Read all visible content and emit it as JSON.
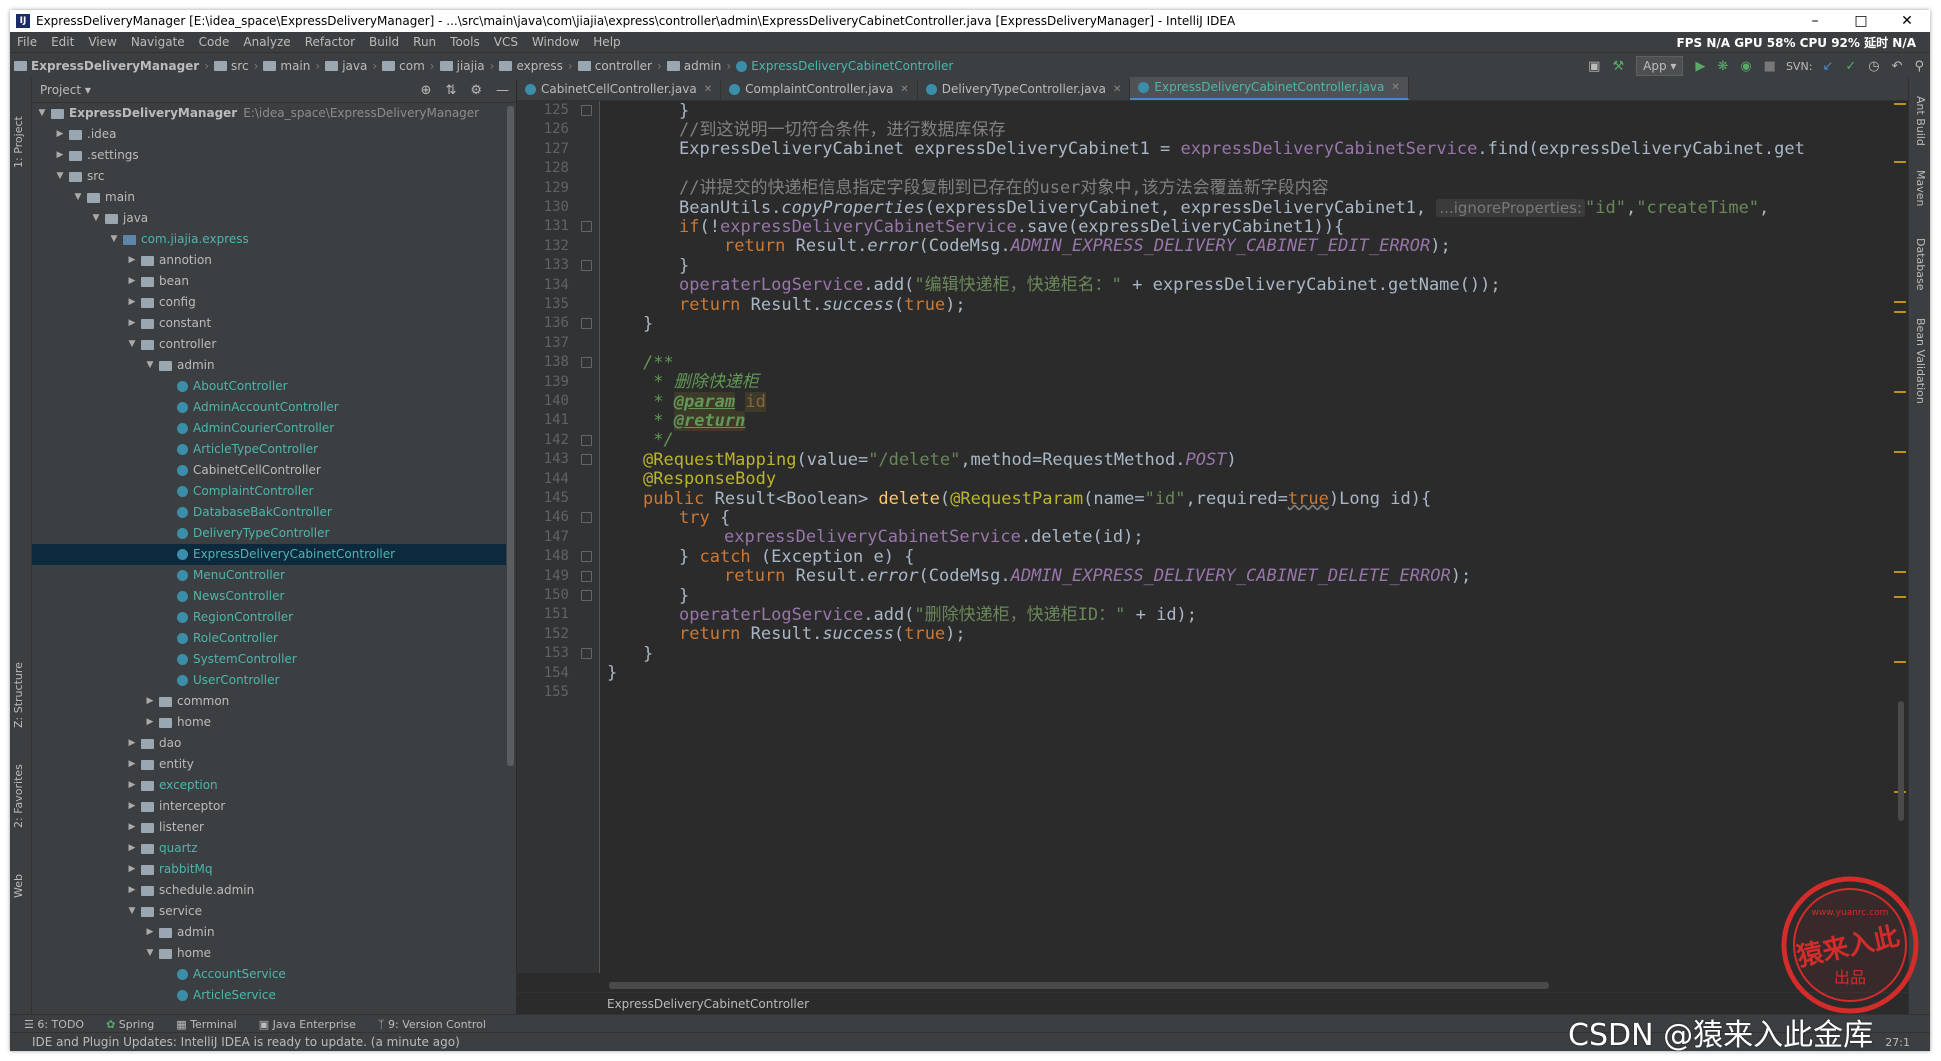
{
  "window": {
    "title": "ExpressDeliveryManager [E:\\idea_space\\ExpressDeliveryManager] - ...\\src\\main\\java\\com\\jiajia\\express\\controller\\admin\\ExpressDeliveryCabinetController.java [ExpressDeliveryManager] - IntelliJ IDEA",
    "app_icon": "IJ"
  },
  "menu": {
    "items": [
      "File",
      "Edit",
      "View",
      "Navigate",
      "Code",
      "Analyze",
      "Refactor",
      "Build",
      "Run",
      "Tools",
      "VCS",
      "Window",
      "Help"
    ],
    "perf": "FPS N/A GPU 58% CPU 92% 延时 N/A"
  },
  "nav": {
    "crumbs": [
      "ExpressDeliveryManager",
      "src",
      "main",
      "java",
      "com",
      "jiajia",
      "express",
      "controller",
      "admin"
    ],
    "current": "ExpressDeliveryCabinetController",
    "run_config": "App ▾",
    "svn_label": "SVN:"
  },
  "left_strip": {
    "project": "1: Project",
    "structure": "Z: Structure",
    "favorites": "2: Favorites",
    "web": "Web"
  },
  "right_strip": {
    "ant": "Ant Build",
    "maven": "Maven",
    "database": "Database",
    "bean": "Bean Validation"
  },
  "project": {
    "header": "Project ▾",
    "root_name": "ExpressDeliveryManager",
    "root_path": "E:\\idea_space\\ExpressDeliveryManager",
    "tree": [
      {
        "indent": 1,
        "arrow": "▶",
        "icon": "folder",
        "label": ".idea",
        "color": "normal"
      },
      {
        "indent": 1,
        "arrow": "▶",
        "icon": "folder",
        "label": ".settings",
        "color": "normal"
      },
      {
        "indent": 1,
        "arrow": "▼",
        "icon": "folder",
        "label": "src",
        "color": "normal"
      },
      {
        "indent": 2,
        "arrow": "▼",
        "icon": "folder",
        "label": "main",
        "color": "normal"
      },
      {
        "indent": 3,
        "arrow": "▼",
        "icon": "folder",
        "label": "java",
        "color": "normal"
      },
      {
        "indent": 4,
        "arrow": "▼",
        "icon": "pkg",
        "label": "com.jiajia.express",
        "color": "cyan"
      },
      {
        "indent": 5,
        "arrow": "▶",
        "icon": "folder",
        "label": "annotion",
        "color": "normal"
      },
      {
        "indent": 5,
        "arrow": "▶",
        "icon": "folder",
        "label": "bean",
        "color": "normal"
      },
      {
        "indent": 5,
        "arrow": "▶",
        "icon": "folder",
        "label": "config",
        "color": "normal"
      },
      {
        "indent": 5,
        "arrow": "▶",
        "icon": "folder",
        "label": "constant",
        "color": "normal"
      },
      {
        "indent": 5,
        "arrow": "▼",
        "icon": "folder",
        "label": "controller",
        "color": "normal"
      },
      {
        "indent": 6,
        "arrow": "▼",
        "icon": "folder",
        "label": "admin",
        "color": "normal"
      },
      {
        "indent": 7,
        "arrow": "",
        "icon": "cls",
        "label": "AboutController",
        "color": "cyan"
      },
      {
        "indent": 7,
        "arrow": "",
        "icon": "cls",
        "label": "AdminAccountController",
        "color": "cyan"
      },
      {
        "indent": 7,
        "arrow": "",
        "icon": "cls",
        "label": "AdminCourierController",
        "color": "cyan"
      },
      {
        "indent": 7,
        "arrow": "",
        "icon": "cls",
        "label": "ArticleTypeController",
        "color": "cyan"
      },
      {
        "indent": 7,
        "arrow": "",
        "icon": "cls",
        "label": "CabinetCellController",
        "color": "normal"
      },
      {
        "indent": 7,
        "arrow": "",
        "icon": "cls",
        "label": "ComplaintController",
        "color": "cyan"
      },
      {
        "indent": 7,
        "arrow": "",
        "icon": "cls",
        "label": "DatabaseBakController",
        "color": "cyan"
      },
      {
        "indent": 7,
        "arrow": "",
        "icon": "cls",
        "label": "DeliveryTypeController",
        "color": "cyan"
      },
      {
        "indent": 7,
        "arrow": "",
        "icon": "cls",
        "label": "ExpressDeliveryCabinetController",
        "color": "cyan",
        "selected": true
      },
      {
        "indent": 7,
        "arrow": "",
        "icon": "cls",
        "label": "MenuController",
        "color": "cyan"
      },
      {
        "indent": 7,
        "arrow": "",
        "icon": "cls",
        "label": "NewsController",
        "color": "cyan"
      },
      {
        "indent": 7,
        "arrow": "",
        "icon": "cls",
        "label": "RegionController",
        "color": "cyan"
      },
      {
        "indent": 7,
        "arrow": "",
        "icon": "cls",
        "label": "RoleController",
        "color": "cyan"
      },
      {
        "indent": 7,
        "arrow": "",
        "icon": "cls",
        "label": "SystemController",
        "color": "cyan"
      },
      {
        "indent": 7,
        "arrow": "",
        "icon": "cls",
        "label": "UserController",
        "color": "cyan"
      },
      {
        "indent": 6,
        "arrow": "▶",
        "icon": "folder",
        "label": "common",
        "color": "normal"
      },
      {
        "indent": 6,
        "arrow": "▶",
        "icon": "folder",
        "label": "home",
        "color": "normal"
      },
      {
        "indent": 5,
        "arrow": "▶",
        "icon": "folder",
        "label": "dao",
        "color": "normal"
      },
      {
        "indent": 5,
        "arrow": "▶",
        "icon": "folder",
        "label": "entity",
        "color": "normal"
      },
      {
        "indent": 5,
        "arrow": "▶",
        "icon": "folder",
        "label": "exception",
        "color": "cyan"
      },
      {
        "indent": 5,
        "arrow": "▶",
        "icon": "folder",
        "label": "interceptor",
        "color": "normal"
      },
      {
        "indent": 5,
        "arrow": "▶",
        "icon": "folder",
        "label": "listener",
        "color": "normal"
      },
      {
        "indent": 5,
        "arrow": "▶",
        "icon": "folder",
        "label": "quartz",
        "color": "cyan"
      },
      {
        "indent": 5,
        "arrow": "▶",
        "icon": "folder",
        "label": "rabbitMq",
        "color": "cyan"
      },
      {
        "indent": 5,
        "arrow": "▶",
        "icon": "folder",
        "label": "schedule.admin",
        "color": "normal"
      },
      {
        "indent": 5,
        "arrow": "▼",
        "icon": "folder",
        "label": "service",
        "color": "normal"
      },
      {
        "indent": 6,
        "arrow": "▶",
        "icon": "folder",
        "label": "admin",
        "color": "normal"
      },
      {
        "indent": 6,
        "arrow": "▼",
        "icon": "folder",
        "label": "home",
        "color": "normal"
      },
      {
        "indent": 7,
        "arrow": "",
        "icon": "cls",
        "label": "AccountService",
        "color": "cyan"
      },
      {
        "indent": 7,
        "arrow": "",
        "icon": "cls",
        "label": "ArticleService",
        "color": "cyan"
      }
    ]
  },
  "editor": {
    "tabs": [
      {
        "label": "CabinetCellController.java",
        "active": false
      },
      {
        "label": "ComplaintController.java",
        "active": false
      },
      {
        "label": "DeliveryTypeController.java",
        "active": false
      },
      {
        "label": "ExpressDeliveryCabinetController.java",
        "active": true
      }
    ],
    "line_numbers": [
      "125",
      "126",
      "127",
      "128",
      "129",
      "130",
      "131",
      "132",
      "133",
      "134",
      "135",
      "136",
      "137",
      "138",
      "139",
      "140",
      "141",
      "142",
      "143",
      "144",
      "145",
      "146",
      "147",
      "148",
      "149",
      "150",
      "151",
      "152",
      "153",
      "154",
      "155"
    ],
    "breadcrumb": "ExpressDeliveryCabinetController",
    "code": {
      "l125": "}",
      "l126": "//到这说明一切符合条件，进行数据库保存",
      "l127_type": "ExpressDeliveryCabinet expressDeliveryCabinet1 = ",
      "l127_svc": "expressDeliveryCabinetService",
      "l127_rest": ".find(expressDeliveryCabinet.get",
      "l129": "//讲提交的快递柜信息指定字段复制到已存在的user对象中,该方法会覆盖新字段内容",
      "l130_a": "BeanUtils.",
      "l130_fn": "copyProperties",
      "l130_b": "(expressDeliveryCabinet, expressDeliveryCabinet1, ",
      "l130_hint": "...ignoreProperties:",
      "l130_s1": "\"id\"",
      "l130_c": ",",
      "l130_s2": "\"createTime\"",
      "l130_d": ",",
      "l131_kw": "if",
      "l131_a": "(!",
      "l131_svc": "expressDeliveryCabinetService",
      "l131_b": ".save(expressDeliveryCabinet1)){",
      "l132_kw": "return",
      "l132_a": " Result.",
      "l132_fn": "error",
      "l132_b": "(CodeMsg.",
      "l132_cst": "ADMIN_EXPRESS_DELIVERY_CABINET_EDIT_ERROR",
      "l132_c": ");",
      "l133": "}",
      "l134_svc": "operaterLogService",
      "l134_a": ".add(",
      "l134_str": "\"编辑快递柜，快递柜名：\"",
      "l134_b": " + expressDeliveryCabinet.getName());",
      "l135_kw": "return",
      "l135_a": " Result.",
      "l135_fn": "success",
      "l135_b": "(",
      "l135_true": "true",
      "l135_c": ");",
      "l136": "}",
      "l138": "/**",
      "l139": " * 删除快递柜",
      "l140_a": " * ",
      "l140_tag": "@param",
      "l140_sp": " ",
      "l140_p": "id",
      "l141_a": " * ",
      "l141_tag": "@return",
      "l142": " */",
      "l143_ann": "@RequestMapping",
      "l143_a": "(value=",
      "l143_str": "\"/delete\"",
      "l143_b": ",method=RequestMethod.",
      "l143_cst": "POST",
      "l143_c": ")",
      "l144_ann": "@ResponseBody",
      "l145_kw": "public",
      "l145_a": " Result<Boolean> ",
      "l145_fn": "delete",
      "l145_b": "(",
      "l145_ann": "@RequestParam",
      "l145_c": "(name=",
      "l145_str": "\"id\"",
      "l145_d": ",required=",
      "l145_true": "true",
      "l145_e": ")Long id){",
      "l146_kw": "try",
      "l146_a": " {",
      "l147_svc": "expressDeliveryCabinetService",
      "l147_a": ".delete(id);",
      "l148_a": "} ",
      "l148_kw": "catch",
      "l148_b": " (Exception e) {",
      "l149_kw": "return",
      "l149_a": " Result.",
      "l149_fn": "error",
      "l149_b": "(CodeMsg.",
      "l149_cst": "ADMIN_EXPRESS_DELIVERY_CABINET_DELETE_ERROR",
      "l149_c": ");",
      "l150": "}",
      "l151_svc": "operaterLogService",
      "l151_a": ".add(",
      "l151_str": "\"删除快递柜，快递柜ID：\"",
      "l151_b": " + id);",
      "l152_kw": "return",
      "l152_a": " Result.",
      "l152_fn": "success",
      "l152_b": "(",
      "l152_true": "true",
      "l152_c": ");",
      "l153": "}",
      "l154": "}"
    }
  },
  "bottom_tools": [
    "6: TODO",
    "Spring",
    "Terminal",
    "Java Enterprise",
    "9: Version Control"
  ],
  "status": {
    "message": "IDE and Plugin Updates: IntelliJ IDEA is ready to update. (a minute ago)",
    "position": "27:1"
  },
  "watermark": {
    "stamp_text": "猿来入此",
    "stamp_sub": "出品",
    "stamp_url": "www.yuanrc.com",
    "csdn": "CSDN @猿来入此金库"
  },
  "colors": {
    "bg": "#2b2b2b",
    "panel": "#3c3f41",
    "keyword": "#cc7832",
    "string": "#6a8759",
    "field": "#9876aa",
    "function": "#ffc66d",
    "comment": "#808080",
    "annotation": "#bbb529"
  }
}
